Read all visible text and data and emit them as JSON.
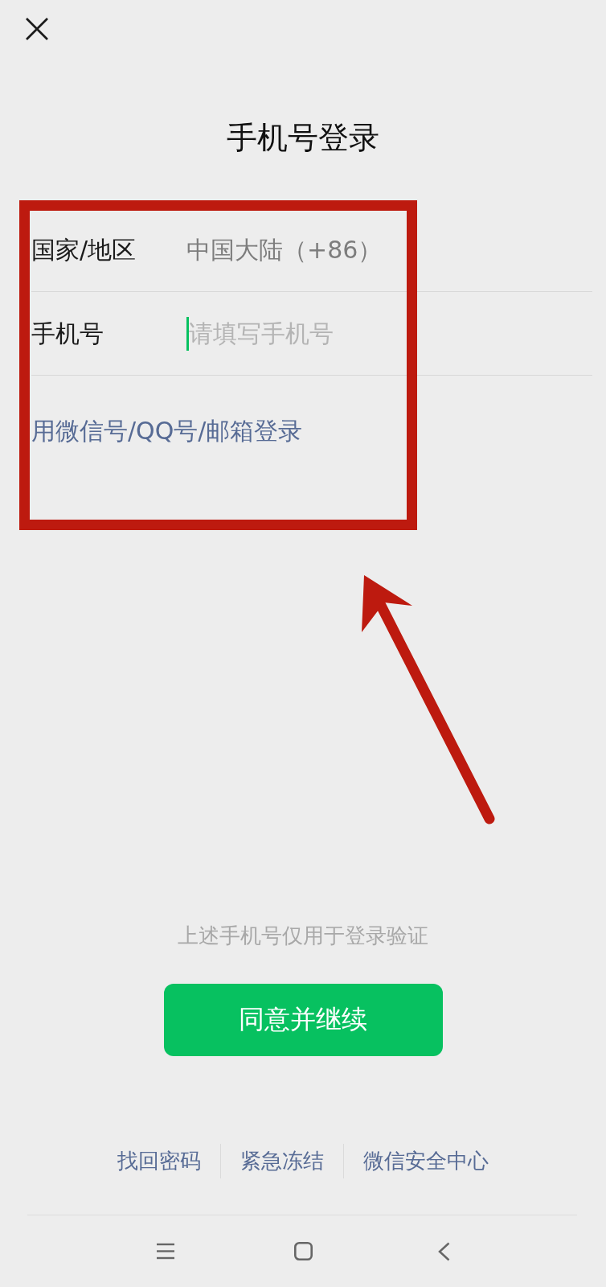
{
  "title": "手机号登录",
  "form": {
    "fields": [
      {
        "kind": "select",
        "label": "国家/地区",
        "value": "中国大陆（+86）"
      },
      {
        "kind": "input",
        "label": "手机号",
        "placeholder": "请填写手机号",
        "focused": true
      }
    ]
  },
  "alt_login_link": "用微信号/QQ号/邮箱登录",
  "notice": "上述手机号仅用于登录验证",
  "submit_button": "同意并继续",
  "footer_links": [
    "找回密码",
    "紧急冻结",
    "微信安全中心"
  ],
  "annotations": {
    "highlight_frame": true,
    "arrow": true
  }
}
